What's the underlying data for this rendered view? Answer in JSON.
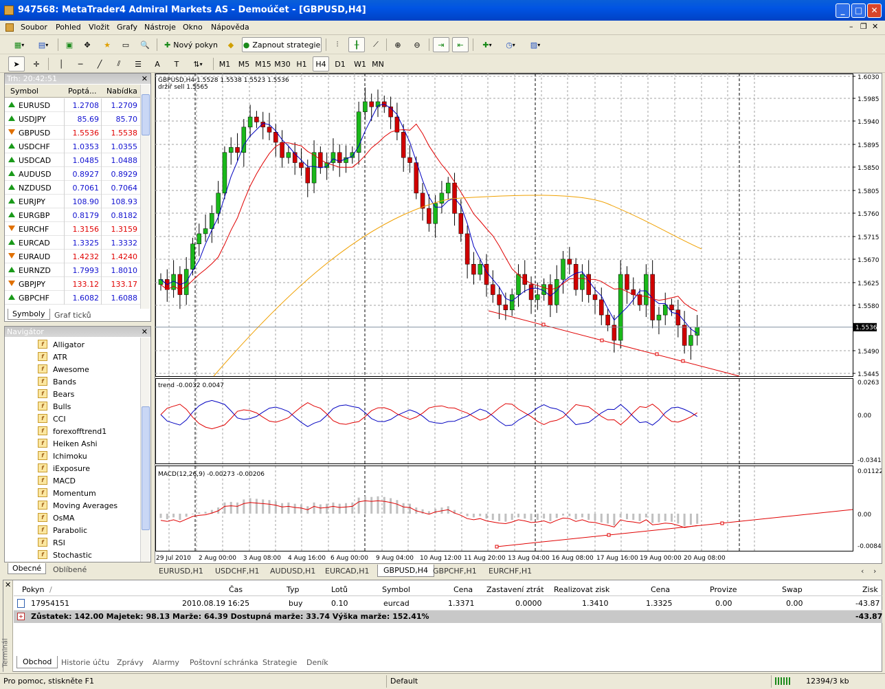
{
  "window": {
    "title": "947568: MetaTrader4 Admiral Markets AS - Demoúčet - [GBPUSD,H4]"
  },
  "menu": [
    "Soubor",
    "Pohled",
    "Vložit",
    "Grafy",
    "Nástroje",
    "Okno",
    "Nápověda"
  ],
  "toolbar": {
    "new_order": "Nový pokyn",
    "strategy": "Zapnout strategie"
  },
  "timeframes": [
    "M1",
    "M5",
    "M15",
    "M30",
    "H1",
    "H4",
    "D1",
    "W1",
    "MN"
  ],
  "active_timeframe": "H4",
  "market_watch": {
    "title": "Trh: 20:42:51",
    "col_symbol": "Symbol",
    "col_bid": "Poptá...",
    "col_ask": "Nabídka",
    "rows": [
      {
        "symbol": "EURUSD",
        "bid": "1.2708",
        "ask": "1.2709",
        "dir": "up",
        "color": "#1010d0"
      },
      {
        "symbol": "USDJPY",
        "bid": "85.69",
        "ask": "85.70",
        "dir": "up",
        "color": "#1010d0"
      },
      {
        "symbol": "GBPUSD",
        "bid": "1.5536",
        "ask": "1.5538",
        "dir": "down",
        "color": "#e00000"
      },
      {
        "symbol": "USDCHF",
        "bid": "1.0353",
        "ask": "1.0355",
        "dir": "up",
        "color": "#1010d0"
      },
      {
        "symbol": "USDCAD",
        "bid": "1.0485",
        "ask": "1.0488",
        "dir": "up",
        "color": "#1010d0"
      },
      {
        "symbol": "AUDUSD",
        "bid": "0.8927",
        "ask": "0.8929",
        "dir": "up",
        "color": "#1010d0"
      },
      {
        "symbol": "NZDUSD",
        "bid": "0.7061",
        "ask": "0.7064",
        "dir": "up",
        "color": "#1010d0"
      },
      {
        "symbol": "EURJPY",
        "bid": "108.90",
        "ask": "108.93",
        "dir": "up",
        "color": "#1010d0"
      },
      {
        "symbol": "EURGBP",
        "bid": "0.8179",
        "ask": "0.8182",
        "dir": "up",
        "color": "#1010d0"
      },
      {
        "symbol": "EURCHF",
        "bid": "1.3156",
        "ask": "1.3159",
        "dir": "down",
        "color": "#e00000"
      },
      {
        "symbol": "EURCAD",
        "bid": "1.3325",
        "ask": "1.3332",
        "dir": "up",
        "color": "#1010d0"
      },
      {
        "symbol": "EURAUD",
        "bid": "1.4232",
        "ask": "1.4240",
        "dir": "down",
        "color": "#e00000"
      },
      {
        "symbol": "EURNZD",
        "bid": "1.7993",
        "ask": "1.8010",
        "dir": "up",
        "color": "#1010d0"
      },
      {
        "symbol": "GBPJPY",
        "bid": "133.12",
        "ask": "133.17",
        "dir": "down",
        "color": "#e00000"
      },
      {
        "symbol": "GBPCHF",
        "bid": "1.6082",
        "ask": "1.6088",
        "dir": "up",
        "color": "#1010d0"
      }
    ],
    "tabs": [
      "Symboly",
      "Graf ticků"
    ]
  },
  "navigator": {
    "title": "Navigátor",
    "items": [
      "Alligator",
      "ATR",
      "Awesome",
      "Bands",
      "Bears",
      "Bulls",
      "CCI",
      "forexofftrend1",
      "Heiken Ashi",
      "Ichimoku",
      "iExposure",
      "MACD",
      "Momentum",
      "Moving Averages",
      "OsMA",
      "Parabolic",
      "RSI",
      "Stochastic"
    ],
    "tabs": [
      "Obecné",
      "Oblíbené"
    ]
  },
  "chart": {
    "header": "GBPUSD,H4  1.5528 1.5538 1.5523 1.5536",
    "subheader": "držíř sell 1.5565",
    "trend_label": "trend -0.0032 0.0047",
    "macd_label": "MACD(12,26,9) -0.00273 -0.00206",
    "price_ticks": [
      "1.6030",
      "1.5985",
      "1.5940",
      "1.5895",
      "1.5850",
      "1.5805",
      "1.5760",
      "1.5715",
      "1.5670",
      "1.5625",
      "1.5580",
      "1.5490",
      "1.5445"
    ],
    "current_price": "1.5536",
    "trend_ticks": [
      "0.0263",
      "0.00",
      "-0.0341"
    ],
    "macd_ticks": [
      "0.01122",
      "0.00",
      "-0.00843"
    ],
    "time_ticks": [
      "29 Jul 2010",
      "2 Aug 00:00",
      "3 Aug 08:00",
      "4 Aug 16:00",
      "6 Aug 00:00",
      "9 Aug 04:00",
      "10 Aug 12:00",
      "11 Aug 20:00",
      "13 Aug 04:00",
      "16 Aug 08:00",
      "17 Aug 16:00",
      "19 Aug 00:00",
      "20 Aug 08:00"
    ]
  },
  "chart_tabs": [
    "EURUSD,H1",
    "USDCHF,H1",
    "AUDUSD,H1",
    "EURCAD,H1",
    "GBPUSD,H4",
    "GBPCHF,H1",
    "EURCHF,H1"
  ],
  "active_chart_tab": "GBPUSD,H4",
  "terminal": {
    "side_label": "Terminál",
    "headers": [
      "Pokyn",
      "/",
      "Čas",
      "Typ",
      "Lotů",
      "Symbol",
      "Cena",
      "Zastavení ztrát",
      "Realizovat zisk",
      "Cena",
      "Provize",
      "Swap",
      "Zisk"
    ],
    "order": {
      "ticket": "17954151",
      "time": "2010.08.19 16:25",
      "type": "buy",
      "lots": "0.10",
      "symbol": "eurcad",
      "price": "1.3371",
      "sl": "0.0000",
      "tp": "1.3410",
      "cur": "1.3325",
      "commission": "0.00",
      "swap": "0.00",
      "profit": "-43.87"
    },
    "balance_line": "Zůstatek: 142.00  Majetek: 98.13  Marže: 64.39  Dostupná marže: 33.74  Výška marže: 152.41%",
    "balance_profit": "-43.87",
    "tabs": [
      "Obchod",
      "Historie účtu",
      "Zprávy",
      "Alarmy",
      "Poštovní schránka",
      "Strategie",
      "Deník"
    ]
  },
  "status": {
    "help": "Pro pomoc, stiskněte F1",
    "profile": "Default",
    "traffic": "12394/3 kb"
  }
}
